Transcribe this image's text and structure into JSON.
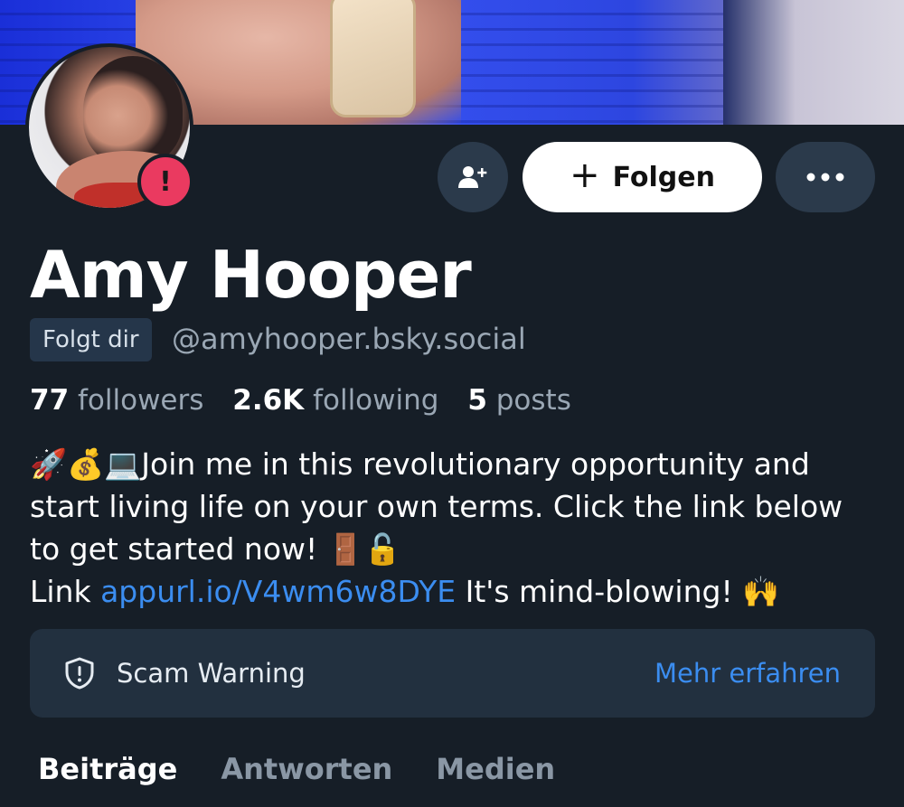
{
  "profile": {
    "display_name": "Amy Hooper",
    "follows_you_label": "Folgt dir",
    "handle": "@amyhooper.bsky.social",
    "alert_badge": "!"
  },
  "actions": {
    "follow_label": "Folgen",
    "follow_plus": "+",
    "more_label": "•••"
  },
  "stats": {
    "followers_count": "77",
    "followers_label": "followers",
    "following_count": "2.6K",
    "following_label": "following",
    "posts_count": "5",
    "posts_label": "posts"
  },
  "bio": {
    "line1_emoji": "🚀💰💻",
    "line1_text": "Join me in this revolutionary opportunity and start living life on your own terms. Click the link below to get started now! ",
    "line1_emoji_end": "🚪🔓",
    "link_prefix": "Link ",
    "link_url": "appurl.io/V4wm6w8DYE",
    "link_suffix": " It's mind-blowing! ",
    "link_suffix_emoji": "🙌"
  },
  "warning": {
    "label": "Scam Warning",
    "action": "Mehr erfahren"
  },
  "tabs": [
    {
      "label": "Beiträge",
      "active": true
    },
    {
      "label": "Antworten",
      "active": false
    },
    {
      "label": "Medien",
      "active": false
    }
  ],
  "colors": {
    "background": "#161e27",
    "accent_link": "#3b8df0",
    "alert": "#ea3a60"
  }
}
